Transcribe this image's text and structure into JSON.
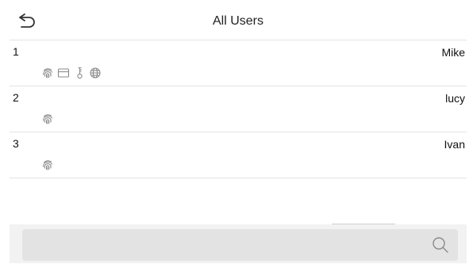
{
  "header": {
    "title": "All Users",
    "back_icon": "back-arrow-icon"
  },
  "users": [
    {
      "number": "1",
      "name": "Mike",
      "icons": [
        "fingerprint-icon",
        "card-icon",
        "password-key-icon",
        "face-icon"
      ]
    },
    {
      "number": "2",
      "name": "lucy",
      "icons": [
        "fingerprint-icon"
      ]
    },
    {
      "number": "3",
      "name": "Ivan",
      "icons": [
        "fingerprint-icon"
      ]
    }
  ],
  "search": {
    "icon": "search-icon"
  },
  "colors": {
    "icon_gray": "#8a8a8a",
    "divider": "#e4e4e4",
    "footer_bg": "#f2f2f2",
    "search_bg": "#e3e3e3"
  }
}
